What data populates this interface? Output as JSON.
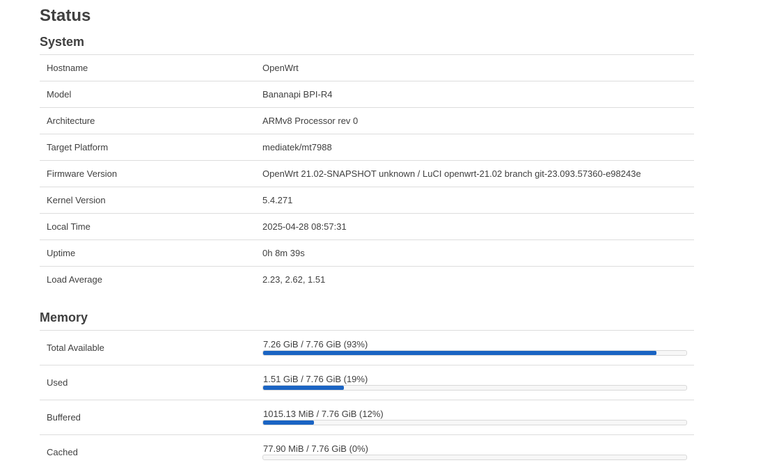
{
  "page": {
    "title": "Status"
  },
  "system": {
    "title": "System",
    "rows": [
      {
        "label": "Hostname",
        "value": "OpenWrt"
      },
      {
        "label": "Model",
        "value": "Bananapi BPI-R4"
      },
      {
        "label": "Architecture",
        "value": "ARMv8 Processor rev 0"
      },
      {
        "label": "Target Platform",
        "value": "mediatek/mt7988"
      },
      {
        "label": "Firmware Version",
        "value": "OpenWrt 21.02-SNAPSHOT unknown / LuCI openwrt-21.02 branch git-23.093.57360-e98243e"
      },
      {
        "label": "Kernel Version",
        "value": "5.4.271"
      },
      {
        "label": "Local Time",
        "value": "2025-04-28 08:57:31"
      },
      {
        "label": "Uptime",
        "value": "0h 8m 39s"
      },
      {
        "label": "Load Average",
        "value": "2.23, 2.62, 1.51"
      }
    ]
  },
  "memory": {
    "title": "Memory",
    "bar_color": "#1a64c3",
    "rows": [
      {
        "label": "Total Available",
        "text": "7.26 GiB / 7.76 GiB (93%)",
        "percent": 93
      },
      {
        "label": "Used",
        "text": "1.51 GiB / 7.76 GiB (19%)",
        "percent": 19
      },
      {
        "label": "Buffered",
        "text": "1015.13 MiB / 7.76 GiB (12%)",
        "percent": 12
      },
      {
        "label": "Cached",
        "text": "77.90 MiB / 7.76 GiB (0%)",
        "percent": 0
      }
    ]
  }
}
